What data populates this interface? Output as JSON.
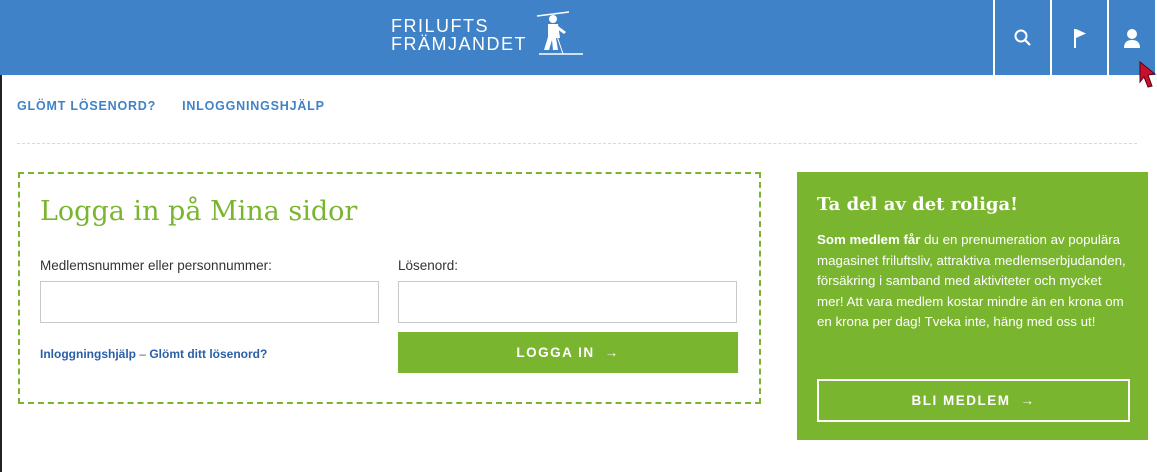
{
  "header": {
    "logo_line1": "FRILUFTS",
    "logo_line2": "FRÄMJANDET",
    "bg_color": "#3f82c8",
    "icons": [
      "search-icon",
      "flag-icon",
      "user-icon"
    ]
  },
  "subnav": {
    "forgot": "GLÖMT LÖSENORD?",
    "help": "INLOGGNINGSHJÄLP"
  },
  "login": {
    "title": "Logga in på Mina sidor",
    "member_label": "Medlemsnummer eller personnummer:",
    "member_value": "",
    "password_label": "Lösenord:",
    "password_value": "",
    "help_link": "Inloggningshjälp",
    "separator": " – ",
    "forgot_link": "Glömt ditt lösenord?",
    "button": "LOGGA IN",
    "button_arrow": "→",
    "accent": "#7ab52f"
  },
  "promo": {
    "title": "Ta del av det roliga!",
    "bold_lead": "Som medlem får",
    "body": " du en prenumeration av populära magasinet friluftsliv, attraktiva medlemserbjudanden, försäkring i samband med aktiviteter och mycket mer! Att vara medlem kostar mindre än en krona om en krona per dag! Tveka inte, häng med oss ut!",
    "button": "BLI MEDLEM",
    "button_arrow": "→"
  }
}
